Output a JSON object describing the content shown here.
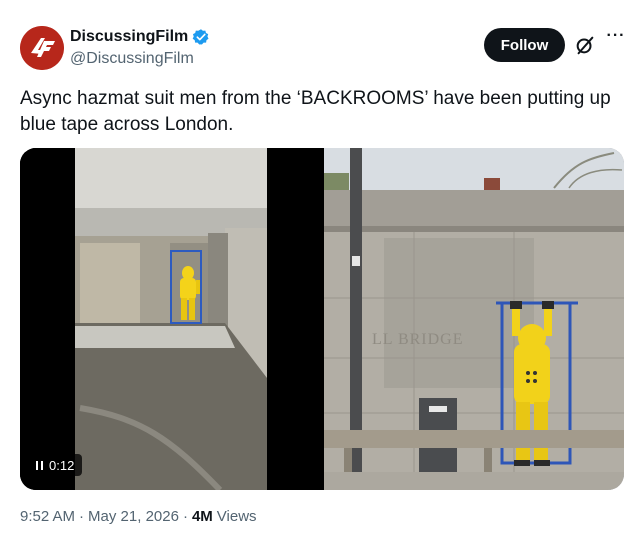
{
  "account": {
    "display_name": "DiscussingFilm",
    "handle": "@DiscussingFilm",
    "avatar_icon": "discussingfilm-logo-icon",
    "avatar_color": "#b7271b",
    "verified_icon": "verified-badge-icon",
    "verified_color": "#1d9bf0"
  },
  "actions": {
    "follow_label": "Follow",
    "grok_icon": "grok-icon",
    "more_icon": "more-options-icon",
    "more_glyph": "···"
  },
  "tweet": {
    "text": "Async hazmat suit men from the ‘BACKROOMS’ have been putting up blue tape across London."
  },
  "media": {
    "video": {
      "duration": "0:12",
      "scene": "hazmat-suit-figure-in-tunnel"
    },
    "photo": {
      "scene": "hazmat-suit-figure-taping-bridge-wall",
      "wall_text": "LL BRIDGE"
    }
  },
  "meta": {
    "time": "9:52 AM",
    "separator": "·",
    "date": "May 21, 2026",
    "views_count": "4M",
    "views_label": "Views"
  }
}
